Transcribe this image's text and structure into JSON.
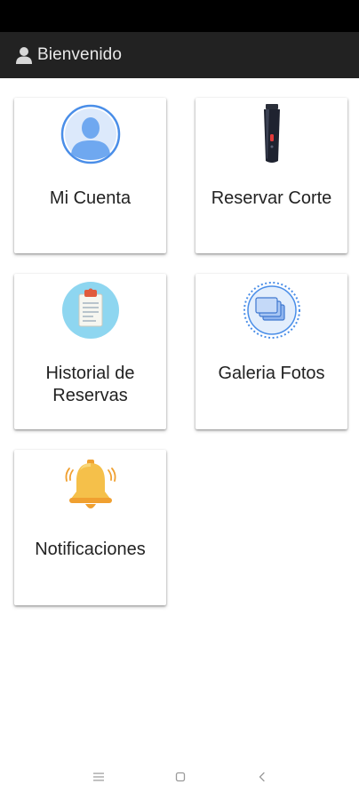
{
  "header": {
    "title": "Bienvenido",
    "icon": "person-icon"
  },
  "menu": {
    "items": [
      {
        "label": "Mi Cuenta",
        "icon": "account-avatar-icon"
      },
      {
        "label": "Reservar Corte",
        "icon": "hair-clipper-icon"
      },
      {
        "label": "Historial de Reservas",
        "icon": "clipboard-icon"
      },
      {
        "label": "Galeria Fotos",
        "icon": "photo-gallery-icon"
      },
      {
        "label": "Notificaciones",
        "icon": "bell-icon"
      }
    ]
  },
  "system_nav": {
    "buttons": [
      "menu",
      "home",
      "back"
    ]
  },
  "colors": {
    "status_bar": "#000000",
    "app_bar": "#222222",
    "card_background": "#ffffff",
    "avatar_blue": "#5aa0f0",
    "clipboard_circle": "#8ed6f0",
    "bell_yellow": "#f5c04a"
  }
}
